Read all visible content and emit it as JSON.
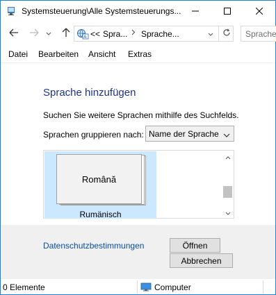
{
  "window": {
    "title": "Systemsteuerung\\Alle Systemsteuerungs..."
  },
  "address": {
    "overflow": "<<",
    "crumbs": [
      "Spra...",
      "Sprache..."
    ],
    "search_placeholder": "Sprache"
  },
  "menu": {
    "items": [
      "Datei",
      "Bearbeiten",
      "Ansicht",
      "Extras"
    ]
  },
  "content": {
    "heading": "Sprache hinzufügen",
    "description": "Suchen Sie weitere Sprachen mithilfe des Suchfelds.",
    "group_label": "Sprachen gruppieren nach:",
    "group_value": "Name der Sprache",
    "languages": [
      {
        "native": "Română",
        "name": "Rumänisch",
        "selected": true
      }
    ]
  },
  "footer": {
    "privacy_link": "Datenschutzbestimmungen",
    "open_button": "Öffnen",
    "cancel_button": "Abbrechen"
  },
  "status": {
    "count": "0 Elemente",
    "zone": "Computer"
  },
  "colors": {
    "accent": "#1883d7",
    "heading": "#1e3287",
    "selection": "#cce8ff",
    "link": "#0a4ea1",
    "footer_bg": "#f0f0f0"
  }
}
